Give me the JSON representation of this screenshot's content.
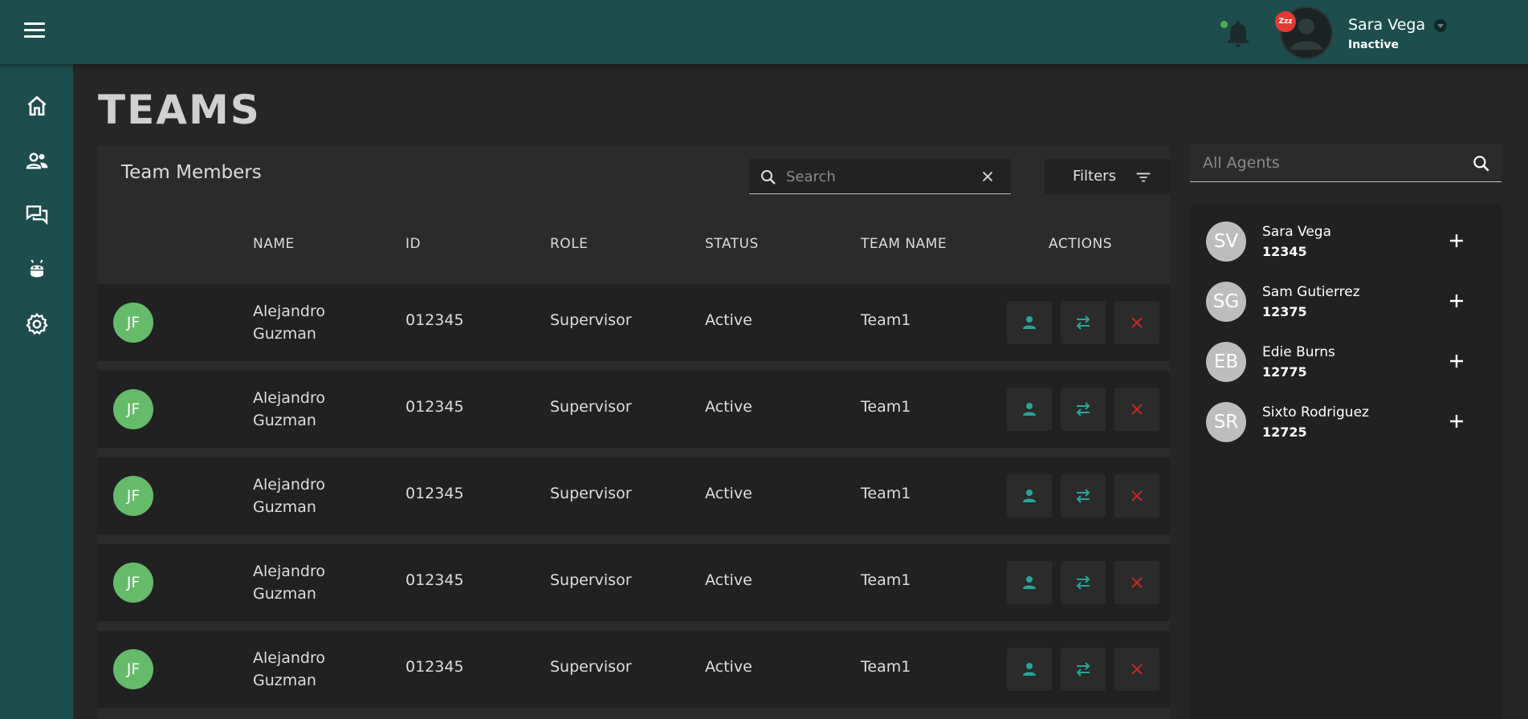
{
  "user": {
    "name": "Sara Vega",
    "status": "Inactive",
    "away_badge": "Zzz"
  },
  "page": {
    "title": "TEAMS"
  },
  "team_members": {
    "title": "Team Members",
    "search_placeholder": "Search",
    "filters_label": "Filters",
    "columns": {
      "name": "NAME",
      "id": "ID",
      "role": "ROLE",
      "status": "STATUS",
      "team": "TEAM NAME",
      "actions": "ACTIONS"
    },
    "rows": [
      {
        "initials": "JF",
        "name": "Alejandro Guzman",
        "id": "012345",
        "role": "Supervisor",
        "status": "Active",
        "team": "Team1"
      },
      {
        "initials": "JF",
        "name": "Alejandro Guzman",
        "id": "012345",
        "role": "Supervisor",
        "status": "Active",
        "team": "Team1"
      },
      {
        "initials": "JF",
        "name": "Alejandro Guzman",
        "id": "012345",
        "role": "Supervisor",
        "status": "Active",
        "team": "Team1"
      },
      {
        "initials": "JF",
        "name": "Alejandro Guzman",
        "id": "012345",
        "role": "Supervisor",
        "status": "Active",
        "team": "Team1"
      },
      {
        "initials": "JF",
        "name": "Alejandro Guzman",
        "id": "012345",
        "role": "Supervisor",
        "status": "Active",
        "team": "Team1"
      }
    ]
  },
  "agents": {
    "search_placeholder": "All Agents",
    "items": [
      {
        "initials": "SV",
        "name": "Sara Vega",
        "id": "12345"
      },
      {
        "initials": "SG",
        "name": "Sam Gutierrez",
        "id": "12375"
      },
      {
        "initials": "EB",
        "name": "Edie Burns",
        "id": "12775"
      },
      {
        "initials": "SR",
        "name": "Sixto Rodriguez",
        "id": "12725"
      }
    ]
  },
  "colors": {
    "brand": "#1e4d4d",
    "accent": "#26a69a",
    "danger": "#c62828",
    "avatar_green": "#66bb6a",
    "online_dot": "#4caf50"
  },
  "icons": {
    "sidebar": [
      "home-icon",
      "users-icon",
      "chat-icon",
      "android-icon",
      "settings-icon"
    ],
    "row_actions": [
      "person-icon",
      "transfer-icon",
      "close-icon"
    ]
  }
}
